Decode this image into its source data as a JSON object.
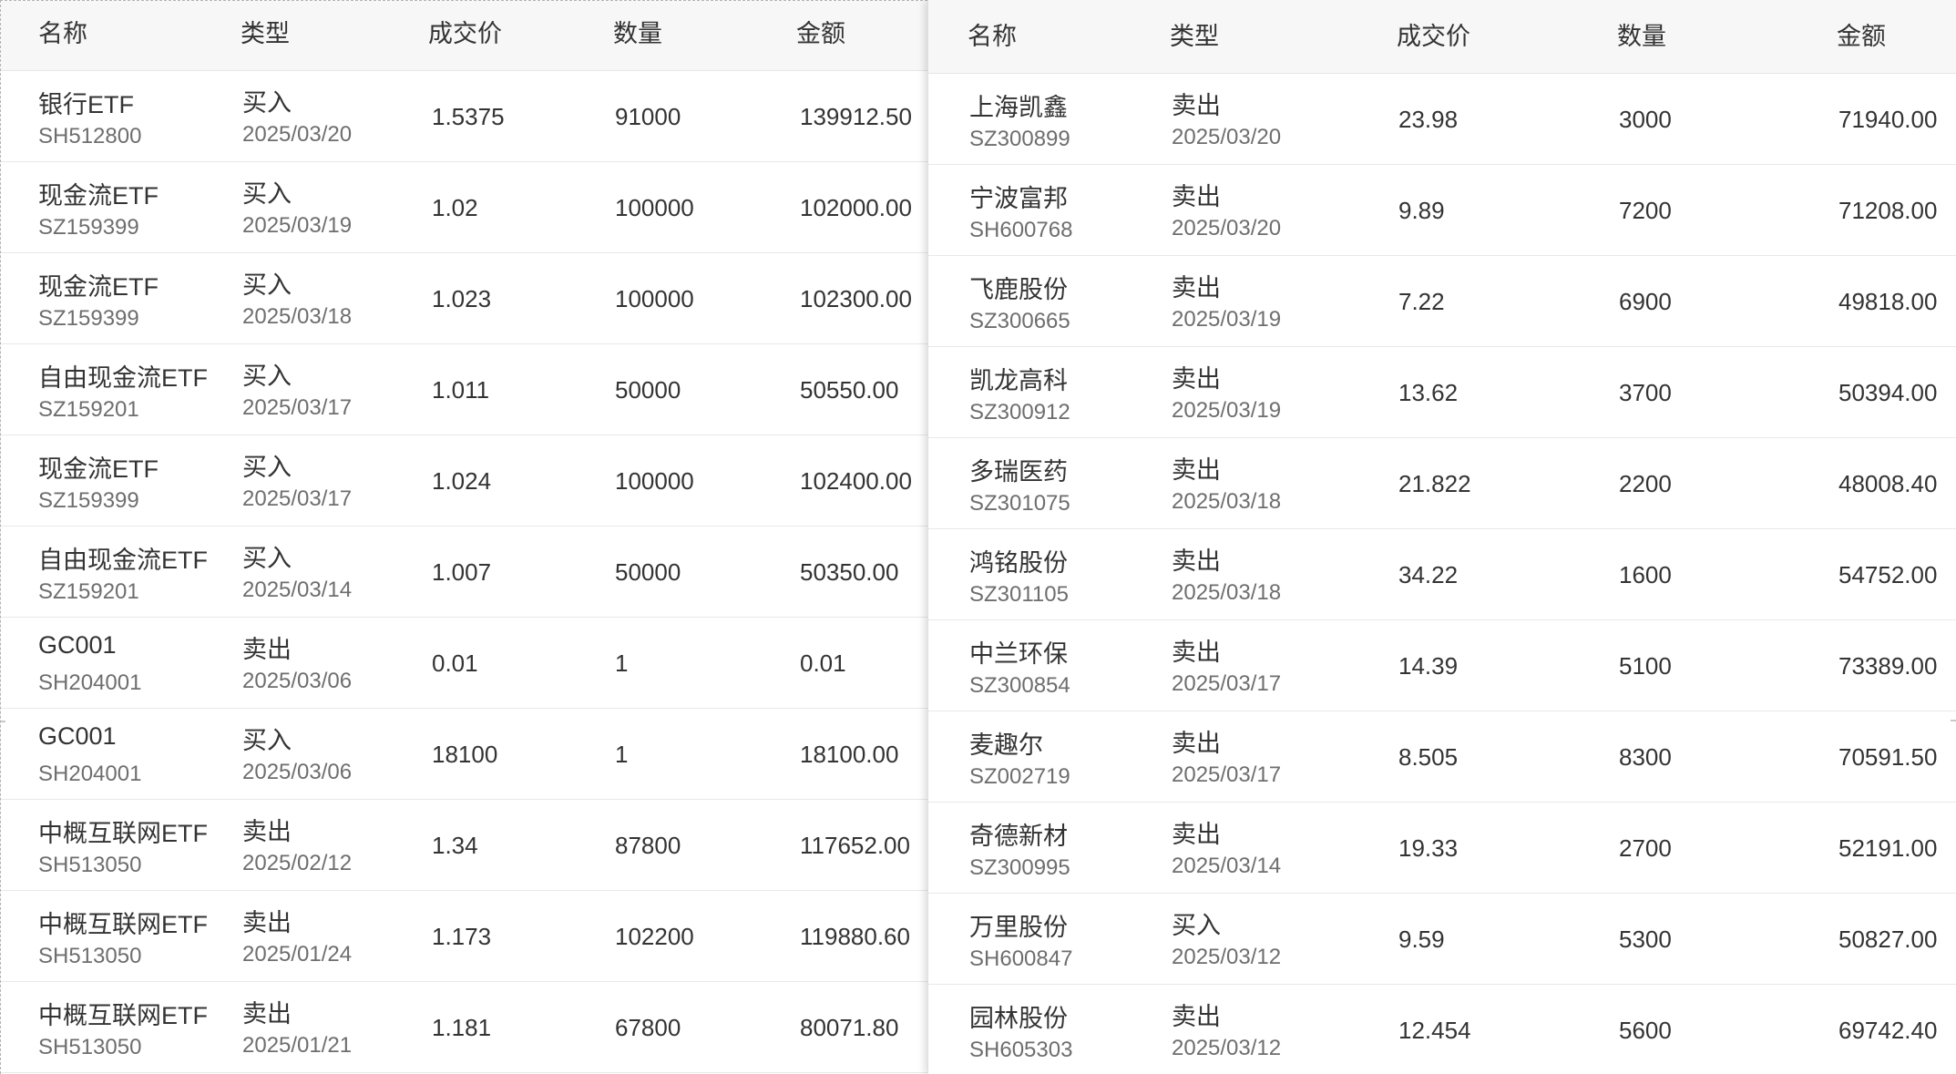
{
  "left_table": {
    "headers": {
      "name": "名称",
      "type": "类型",
      "price": "成交价",
      "qty": "数量",
      "amount": "金额"
    },
    "rows": [
      {
        "name": "银行ETF",
        "code": "SH512800",
        "type": "买入",
        "date": "2025/03/20",
        "price": "1.5375",
        "qty": "91000",
        "amount": "139912.50"
      },
      {
        "name": "现金流ETF",
        "code": "SZ159399",
        "type": "买入",
        "date": "2025/03/19",
        "price": "1.02",
        "qty": "100000",
        "amount": "102000.00"
      },
      {
        "name": "现金流ETF",
        "code": "SZ159399",
        "type": "买入",
        "date": "2025/03/18",
        "price": "1.023",
        "qty": "100000",
        "amount": "102300.00"
      },
      {
        "name": "自由现金流ETF",
        "code": "SZ159201",
        "type": "买入",
        "date": "2025/03/17",
        "price": "1.011",
        "qty": "50000",
        "amount": "50550.00"
      },
      {
        "name": "现金流ETF",
        "code": "SZ159399",
        "type": "买入",
        "date": "2025/03/17",
        "price": "1.024",
        "qty": "100000",
        "amount": "102400.00"
      },
      {
        "name": "自由现金流ETF",
        "code": "SZ159201",
        "type": "买入",
        "date": "2025/03/14",
        "price": "1.007",
        "qty": "50000",
        "amount": "50350.00"
      },
      {
        "name": "GC001",
        "code": "SH204001",
        "type": "卖出",
        "date": "2025/03/06",
        "price": "0.01",
        "qty": "1",
        "amount": "0.01"
      },
      {
        "name": "GC001",
        "code": "SH204001",
        "type": "买入",
        "date": "2025/03/06",
        "price": "18100",
        "qty": "1",
        "amount": "18100.00"
      },
      {
        "name": "中概互联网ETF",
        "code": "SH513050",
        "type": "卖出",
        "date": "2025/02/12",
        "price": "1.34",
        "qty": "87800",
        "amount": "117652.00"
      },
      {
        "name": "中概互联网ETF",
        "code": "SH513050",
        "type": "卖出",
        "date": "2025/01/24",
        "price": "1.173",
        "qty": "102200",
        "amount": "119880.60"
      },
      {
        "name": "中概互联网ETF",
        "code": "SH513050",
        "type": "卖出",
        "date": "2025/01/21",
        "price": "1.181",
        "qty": "67800",
        "amount": "80071.80"
      }
    ]
  },
  "right_table": {
    "headers": {
      "name": "名称",
      "type": "类型",
      "price": "成交价",
      "qty": "数量",
      "amount": "金额"
    },
    "rows": [
      {
        "name": "上海凯鑫",
        "code": "SZ300899",
        "type": "卖出",
        "date": "2025/03/20",
        "price": "23.98",
        "qty": "3000",
        "amount": "71940.00"
      },
      {
        "name": "宁波富邦",
        "code": "SH600768",
        "type": "卖出",
        "date": "2025/03/20",
        "price": "9.89",
        "qty": "7200",
        "amount": "71208.00"
      },
      {
        "name": "飞鹿股份",
        "code": "SZ300665",
        "type": "卖出",
        "date": "2025/03/19",
        "price": "7.22",
        "qty": "6900",
        "amount": "49818.00"
      },
      {
        "name": "凯龙高科",
        "code": "SZ300912",
        "type": "卖出",
        "date": "2025/03/19",
        "price": "13.62",
        "qty": "3700",
        "amount": "50394.00"
      },
      {
        "name": "多瑞医药",
        "code": "SZ301075",
        "type": "卖出",
        "date": "2025/03/18",
        "price": "21.822",
        "qty": "2200",
        "amount": "48008.40"
      },
      {
        "name": "鸿铭股份",
        "code": "SZ301105",
        "type": "卖出",
        "date": "2025/03/18",
        "price": "34.22",
        "qty": "1600",
        "amount": "54752.00"
      },
      {
        "name": "中兰环保",
        "code": "SZ300854",
        "type": "卖出",
        "date": "2025/03/17",
        "price": "14.39",
        "qty": "5100",
        "amount": "73389.00"
      },
      {
        "name": "麦趣尔",
        "code": "SZ002719",
        "type": "卖出",
        "date": "2025/03/17",
        "price": "8.505",
        "qty": "8300",
        "amount": "70591.50"
      },
      {
        "name": "奇德新材",
        "code": "SZ300995",
        "type": "卖出",
        "date": "2025/03/14",
        "price": "19.33",
        "qty": "2700",
        "amount": "52191.00"
      },
      {
        "name": "万里股份",
        "code": "SH600847",
        "type": "买入",
        "date": "2025/03/12",
        "price": "9.59",
        "qty": "5300",
        "amount": "50827.00"
      },
      {
        "name": "园林股份",
        "code": "SH605303",
        "type": "卖出",
        "date": "2025/03/12",
        "price": "12.454",
        "qty": "5600",
        "amount": "69742.40"
      }
    ]
  }
}
